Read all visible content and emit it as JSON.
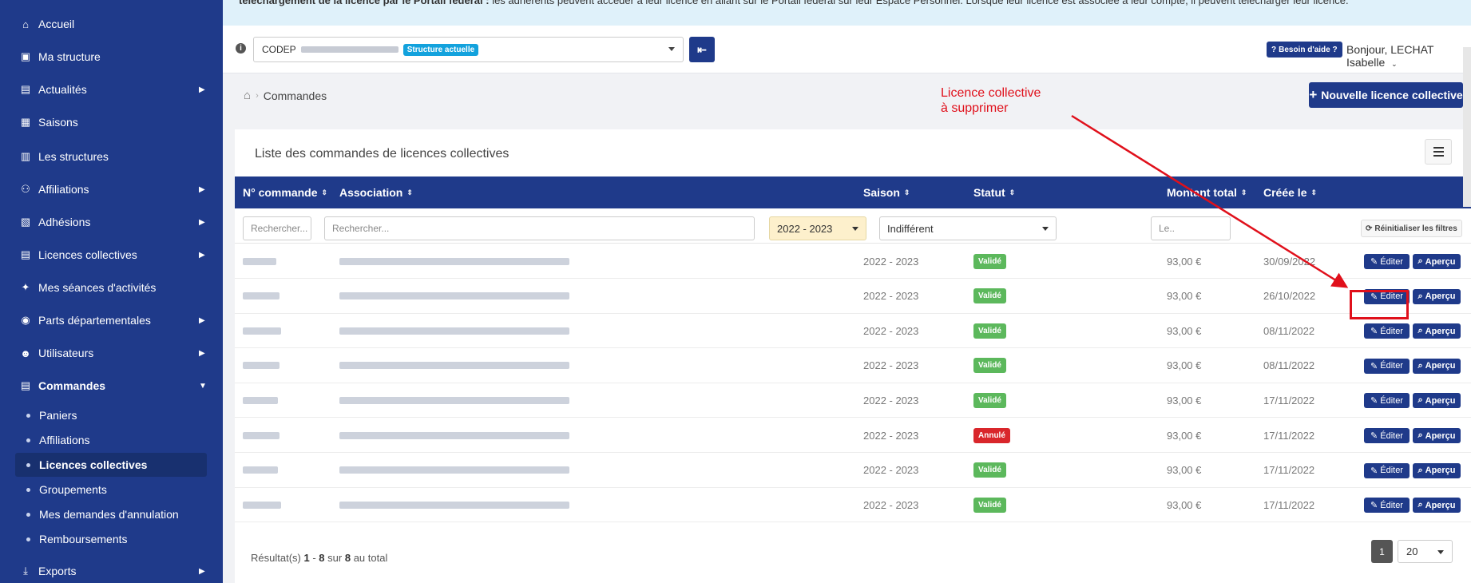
{
  "sidebar": {
    "items": [
      {
        "label": "Accueil",
        "icon": "home-icon",
        "glyph": "⌂",
        "has_children": false
      },
      {
        "label": "Ma structure",
        "icon": "id-card-icon",
        "glyph": "▣",
        "has_children": false
      },
      {
        "label": "Actualités",
        "icon": "newspaper-icon",
        "glyph": "▤",
        "has_children": true
      },
      {
        "label": "Saisons",
        "icon": "calendar-icon",
        "glyph": "▦",
        "has_children": false
      },
      {
        "label": "Les structures",
        "icon": "building-icon",
        "glyph": "▥",
        "has_children": false
      },
      {
        "label": "Affiliations",
        "icon": "sitemap-icon",
        "glyph": "⚇",
        "has_children": true
      },
      {
        "label": "Adhésions",
        "icon": "file-icon",
        "glyph": "▧",
        "has_children": true
      },
      {
        "label": "Licences collectives",
        "icon": "list-icon",
        "glyph": "▤",
        "has_children": true
      },
      {
        "label": "Mes séances d'activités",
        "icon": "running-icon",
        "glyph": "✦",
        "has_children": false
      },
      {
        "label": "Parts départementales",
        "icon": "coins-icon",
        "glyph": "◉",
        "has_children": true
      },
      {
        "label": "Utilisateurs",
        "icon": "users-icon",
        "glyph": "☻",
        "has_children": true
      },
      {
        "label": "Commandes",
        "icon": "receipt-icon",
        "glyph": "▤",
        "has_children": true,
        "expanded": true
      },
      {
        "label": "Exports",
        "icon": "download-icon",
        "glyph": "⤓",
        "has_children": true
      }
    ],
    "sub_items": [
      {
        "label": "Paniers",
        "active": false
      },
      {
        "label": "Affiliations",
        "active": false
      },
      {
        "label": "Licences collectives",
        "active": true
      },
      {
        "label": "Groupements",
        "active": false
      },
      {
        "label": "Mes demandes d'annulation",
        "active": false
      },
      {
        "label": "Remboursements",
        "active": false
      }
    ]
  },
  "banner": {
    "prefix": "téléchargement de la licence par le Portail fédéral :",
    "text": " les adhérents peuvent accéder à leur licence en allant sur le Portail fédéral sur leur Espace Personnel. Lorsque leur licence est associée à leur compte, il peuvent télécharger leur licence."
  },
  "topbar": {
    "structure_prefix": "CODEP",
    "structure_badge": "Structure actuelle",
    "help_label": "Besoin d'aide ?",
    "greeting_prefix": "Bonjour,",
    "user_name": "LECHAT Isabelle"
  },
  "breadcrumb": {
    "current": "Commandes"
  },
  "new_button_label": "Nouvelle licence collective",
  "annotation": {
    "line1": "Licence collective",
    "line2": "à supprimer"
  },
  "card": {
    "title": "Liste des commandes de licences collectives"
  },
  "table": {
    "columns": [
      "N° commande",
      "Association",
      "Saison",
      "Statut",
      "Montant total",
      "Créée le"
    ],
    "filters": {
      "order_placeholder": "Rechercher...",
      "association_placeholder": "Rechercher...",
      "season_value": "2022 - 2023",
      "status_value": "Indifférent",
      "date_placeholder": "Le..",
      "reset_label": "Réinitialiser les filtres"
    },
    "edit_label": "Éditer",
    "view_label": "Aperçu",
    "rows": [
      {
        "season": "2022 - 2023",
        "status": "Validé",
        "status_color": "#5cb85c",
        "amount": "93,00 €",
        "created": "30/09/2022"
      },
      {
        "season": "2022 - 2023",
        "status": "Validé",
        "status_color": "#5cb85c",
        "amount": "93,00 €",
        "created": "26/10/2022"
      },
      {
        "season": "2022 - 2023",
        "status": "Validé",
        "status_color": "#5cb85c",
        "amount": "93,00 €",
        "created": "08/11/2022"
      },
      {
        "season": "2022 - 2023",
        "status": "Validé",
        "status_color": "#5cb85c",
        "amount": "93,00 €",
        "created": "08/11/2022"
      },
      {
        "season": "2022 - 2023",
        "status": "Validé",
        "status_color": "#5cb85c",
        "amount": "93,00 €",
        "created": "17/11/2022"
      },
      {
        "season": "2022 - 2023",
        "status": "Annulé",
        "status_color": "#d9262b",
        "amount": "93,00 €",
        "created": "17/11/2022"
      },
      {
        "season": "2022 - 2023",
        "status": "Validé",
        "status_color": "#5cb85c",
        "amount": "93,00 €",
        "created": "17/11/2022"
      },
      {
        "season": "2022 - 2023",
        "status": "Validé",
        "status_color": "#5cb85c",
        "amount": "93,00 €",
        "created": "17/11/2022"
      }
    ]
  },
  "pagination": {
    "result_label": "Résultat(s)",
    "from": "1",
    "to": "8",
    "sur": "sur",
    "total": "8",
    "suffix": "au total",
    "current_page": "1",
    "page_size": "20"
  },
  "colors": {
    "primary": "#1f3a8a",
    "valid": "#5cb85c",
    "cancelled": "#d9262b",
    "annotation": "#e0101b"
  }
}
